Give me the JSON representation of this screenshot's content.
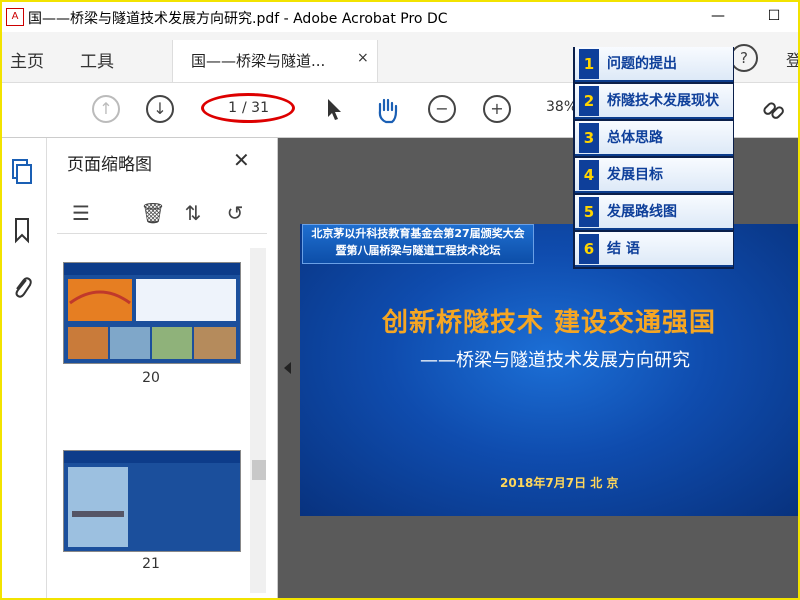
{
  "window": {
    "title": "国——桥梁与隧道技术发展方向研究.pdf - Adobe Acrobat Pro DC",
    "minimize": "—",
    "maximize": "☐"
  },
  "tabs": {
    "home": "主页",
    "tools": "工具",
    "document": "国——桥梁与隧道...",
    "close": "×",
    "help": "?",
    "user_partial": "登"
  },
  "toolbar": {
    "page_current": "1",
    "page_total": "/ 31",
    "zoom": "38%"
  },
  "thumbnails": {
    "title": "页面缩略图",
    "close": "✕",
    "items": [
      {
        "label": "20"
      },
      {
        "label": "21"
      }
    ]
  },
  "slide": {
    "header_line1": "北京茅以升科技教育基金会第27届颁奖大会",
    "header_line2": "暨第八届桥梁与隧道工程技术论坛",
    "title": "创新桥隧技术  建设交通强国",
    "subtitle": "——桥梁与隧道技术发展方向研究",
    "date": "2018年7月7日     北 京"
  },
  "outline": {
    "items": [
      {
        "num": "1",
        "text": "问题的提出"
      },
      {
        "num": "2",
        "text": "桥隧技术发展现状"
      },
      {
        "num": "3",
        "text": "总体思路"
      },
      {
        "num": "4",
        "text": "发展目标"
      },
      {
        "num": "5",
        "text": "发展路线图"
      },
      {
        "num": "6",
        "text": "结    语"
      }
    ]
  },
  "colors": {
    "frame_border": "#f2e300",
    "slide_bg": "#0f4cae",
    "slide_title": "#f5a623",
    "annotation": "#dd0000"
  }
}
